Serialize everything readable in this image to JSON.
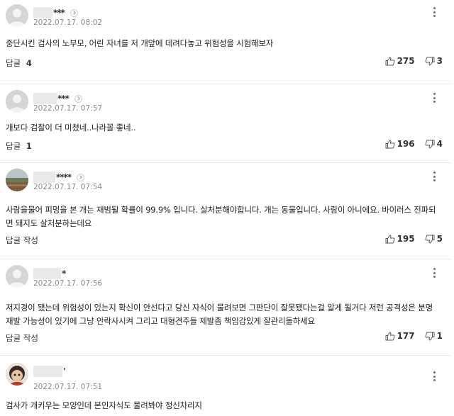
{
  "comments": [
    {
      "name_suffix": "***",
      "date": "2022.07.17. 08:02",
      "body": "중단시킨 검사의 노부모, 어린 자녀를 저 개앞에 데려다놓고 위험성을 시험해보자",
      "reply_label": "답글",
      "reply_count": "4",
      "likes": "275",
      "dislikes": "3",
      "avatar": "default-avatar"
    },
    {
      "name_suffix": "***",
      "date": "2022.07.17. 07:57",
      "body": "개보다 검찰이 더 미쳤네..나라꼴 좋네..",
      "reply_label": "답글",
      "reply_count": "1",
      "likes": "196",
      "dislikes": "4",
      "avatar": "default-avatar"
    },
    {
      "name_suffix": "****",
      "date": "2022.07.17. 07:54",
      "body": "사람을물어 피멍을 본 개는 재범될 확률이 99.9% 입니다. 살처분해야합니다. 개는 동물입니다. 사람이 아니에요. 바이러스 전파되면 돼지도 살처분하는데요",
      "reply_label": "답글 작성",
      "reply_count": "",
      "likes": "195",
      "dislikes": "5",
      "avatar": "photo-avatar"
    },
    {
      "name_suffix": "*",
      "date": "2022.07.17. 07:56",
      "body": "저지경이 됐는데 위험성이 있는지 확신이 안선다고 당신 자식이 물려보면 그판단이 잘못됐다는걸 알게 될거다 저런 공격성은 분명 재발 가능성이 있기에 그냥 안락사시켜 그리고 대형견주들 제발좀 책임감있게 잘관리들하세요",
      "reply_label": "답글 작성",
      "reply_count": "",
      "likes": "177",
      "dislikes": "1",
      "avatar": "default-avatar"
    },
    {
      "name_suffix": "'",
      "date": "2022.07.17. 07:51",
      "body": "검사가 개키우는 모양인데 본인자식도 물려봐야 정신차리지",
      "reply_label": "",
      "reply_count": "",
      "likes": "",
      "dislikes": "",
      "avatar": "character-avatar"
    }
  ],
  "colors": {
    "date": "#8b8b8b",
    "divider": "#ececec",
    "mask": "#e9e9e9"
  }
}
